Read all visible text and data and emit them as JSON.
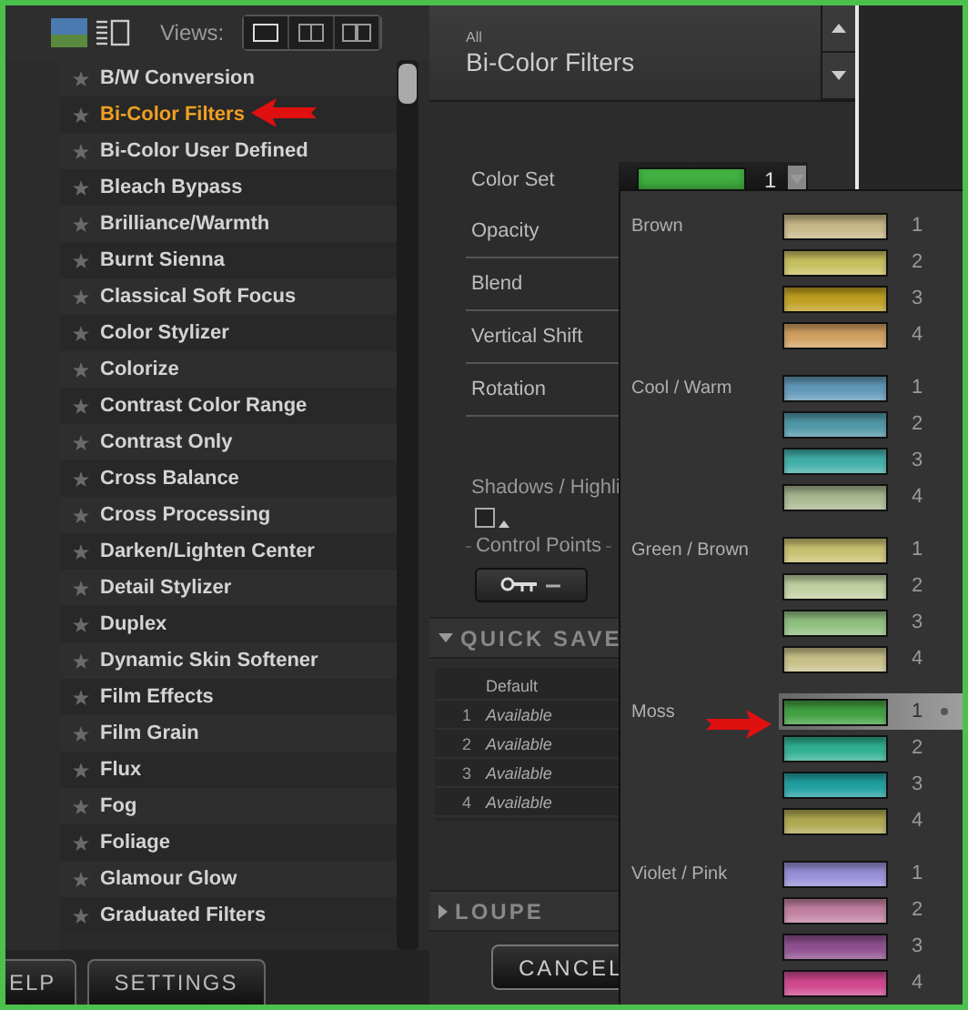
{
  "toolbar": {
    "views_label": "Views:"
  },
  "filters": [
    {
      "label": "B/W Conversion",
      "selected": false
    },
    {
      "label": "Bi-Color Filters",
      "selected": true
    },
    {
      "label": "Bi-Color User Defined",
      "selected": false
    },
    {
      "label": "Bleach Bypass",
      "selected": false
    },
    {
      "label": "Brilliance/Warmth",
      "selected": false
    },
    {
      "label": "Burnt Sienna",
      "selected": false
    },
    {
      "label": "Classical Soft Focus",
      "selected": false
    },
    {
      "label": "Color Stylizer",
      "selected": false
    },
    {
      "label": "Colorize",
      "selected": false
    },
    {
      "label": "Contrast Color Range",
      "selected": false
    },
    {
      "label": "Contrast Only",
      "selected": false
    },
    {
      "label": "Cross Balance",
      "selected": false
    },
    {
      "label": "Cross Processing",
      "selected": false
    },
    {
      "label": "Darken/Lighten Center",
      "selected": false
    },
    {
      "label": "Detail Stylizer",
      "selected": false
    },
    {
      "label": "Duplex",
      "selected": false
    },
    {
      "label": "Dynamic Skin Softener",
      "selected": false
    },
    {
      "label": "Film Effects",
      "selected": false
    },
    {
      "label": "Film Grain",
      "selected": false
    },
    {
      "label": "Flux",
      "selected": false
    },
    {
      "label": "Fog",
      "selected": false
    },
    {
      "label": "Foliage",
      "selected": false
    },
    {
      "label": "Glamour Glow",
      "selected": false
    },
    {
      "label": "Graduated Filters",
      "selected": false
    }
  ],
  "bottom_buttons": [
    "ELP",
    "SETTINGS"
  ],
  "header": {
    "category": "All",
    "title": "Bi-Color Filters"
  },
  "color_set": {
    "label": "Color Set",
    "value": "1",
    "color": "#40b040"
  },
  "controls": [
    "Opacity",
    "Blend",
    "Vertical Shift",
    "Rotation"
  ],
  "shadows_highlights": {
    "label": "Shadows / Highli"
  },
  "control_points": {
    "label": "Control Points"
  },
  "quick_save": {
    "title": "QUICK SAVE",
    "expanded": true,
    "header": "Default",
    "rows": [
      {
        "number": "1",
        "name": "Available"
      },
      {
        "number": "2",
        "name": "Available"
      },
      {
        "number": "3",
        "name": "Available"
      },
      {
        "number": "4",
        "name": "Available"
      }
    ]
  },
  "loupe": {
    "title": "LOUPE",
    "expanded": false
  },
  "cancel_button": "CANCEL",
  "color_menu": {
    "groups": [
      {
        "name": "Brown",
        "swatches": [
          {
            "number": "1",
            "color": "#c8b888",
            "selected": false
          },
          {
            "number": "2",
            "color": "#c8c060",
            "selected": false
          },
          {
            "number": "3",
            "color": "#c0a020",
            "selected": false
          },
          {
            "number": "4",
            "color": "#d0a060",
            "selected": false
          }
        ]
      },
      {
        "name": "Cool / Warm",
        "swatches": [
          {
            "number": "1",
            "color": "#6098b8",
            "selected": false
          },
          {
            "number": "2",
            "color": "#5098a8",
            "selected": false
          },
          {
            "number": "3",
            "color": "#40b0a8",
            "selected": false
          },
          {
            "number": "4",
            "color": "#a8b890",
            "selected": false
          }
        ]
      },
      {
        "name": "Green / Brown",
        "swatches": [
          {
            "number": "1",
            "color": "#c8c070",
            "selected": false
          },
          {
            "number": "2",
            "color": "#c0d0a0",
            "selected": false
          },
          {
            "number": "3",
            "color": "#90c080",
            "selected": false
          },
          {
            "number": "4",
            "color": "#c8c088",
            "selected": false
          }
        ]
      },
      {
        "name": "Moss",
        "swatches": [
          {
            "number": "1",
            "color": "#40a040",
            "selected": true
          },
          {
            "number": "2",
            "color": "#30b090",
            "selected": false
          },
          {
            "number": "3",
            "color": "#20a0a0",
            "selected": false
          },
          {
            "number": "4",
            "color": "#b0a850",
            "selected": false
          }
        ]
      },
      {
        "name": "Violet / Pink",
        "swatches": [
          {
            "number": "1",
            "color": "#9890d8",
            "selected": false
          },
          {
            "number": "2",
            "color": "#c080a0",
            "selected": false
          },
          {
            "number": "3",
            "color": "#905090",
            "selected": false
          },
          {
            "number": "4",
            "color": "#d04890",
            "selected": false
          }
        ]
      }
    ]
  }
}
